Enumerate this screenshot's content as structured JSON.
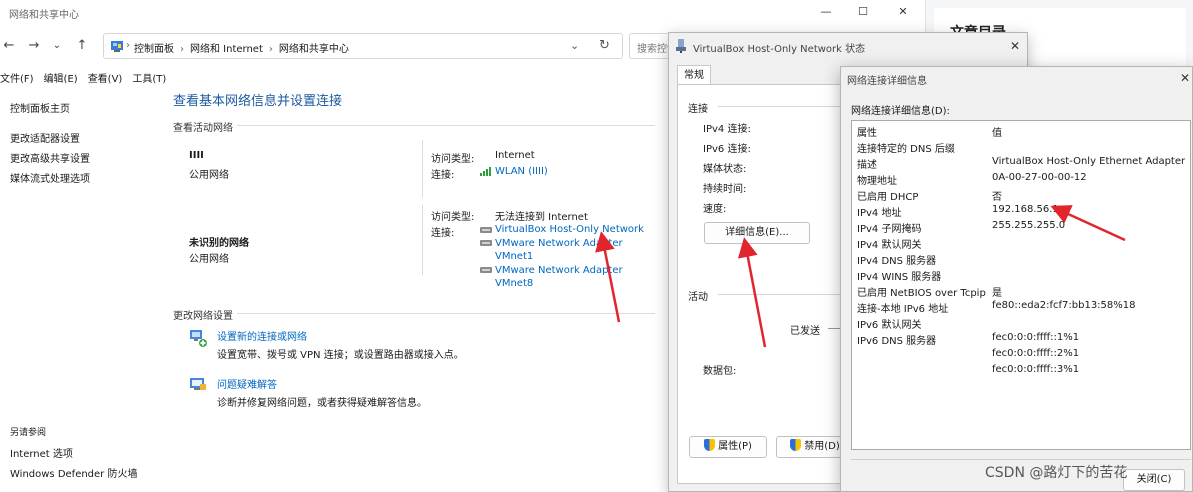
{
  "control_panel": {
    "window_title": "网络和共享中心",
    "window_controls": [
      "—",
      "☐",
      "✕"
    ],
    "nav": {
      "back": "←",
      "forward": "→",
      "recent": "⌄",
      "up": "↑"
    },
    "breadcrumbs": [
      "控制面板",
      "网络和 Internet",
      "网络和共享中心"
    ],
    "breadcrumb_sep": "›",
    "address_dropdown": "⌄",
    "refresh": "↻",
    "search_placeholder": "搜索控制",
    "menu": [
      "文件(F)",
      "编辑(E)",
      "查看(V)",
      "工具(T)"
    ],
    "left_nav": {
      "items": [
        "控制面板主页",
        "更改适配器设置",
        "更改高级共享设置",
        "媒体流式处理选项"
      ],
      "see_also_title": "另请参阅",
      "see_also": [
        "Internet 选项",
        "Windows Defender 防火墙"
      ]
    },
    "main_title": "查看基本网络信息并设置连接",
    "active_networks_title": "查看活动网络",
    "networks": [
      {
        "name": "IIII",
        "category": "公用网络",
        "access_label": "访问类型:",
        "access_value": "Internet",
        "conn_label": "连接:",
        "connections": [
          "WLAN (IIII)"
        ]
      },
      {
        "name": "未识别的网络",
        "category": "公用网络",
        "access_label": "访问类型:",
        "access_value": "无法连接到 Internet",
        "conn_label": "连接:",
        "connections": [
          "VirtualBox Host-Only Network",
          "VMware Network Adapter VMnet1",
          "VMware Network Adapter VMnet8"
        ]
      }
    ],
    "change_settings_title": "更改网络设置",
    "tasks": [
      {
        "title": "设置新的连接或网络",
        "desc": "设置宽带、拨号或 VPN 连接；或设置路由器或接入点。"
      },
      {
        "title": "问题疑难解答",
        "desc": "诊断并修复网络问题，或者获得疑难解答信息。"
      }
    ]
  },
  "csdn": {
    "toc_title": "文章目录",
    "watermark": "CSDN @路灯下的苦花"
  },
  "status_dialog": {
    "title": "VirtualBox Host-Only Network 状态",
    "close": "✕",
    "tab": "常规",
    "connection_group": "连接",
    "fields": [
      "IPv4 连接:",
      "IPv6 连接:",
      "媒体状态:",
      "持续时间:",
      "速度:"
    ],
    "details_button": "详细信息(E)...",
    "activity_group": "活动",
    "sent_label": "已发送",
    "packets_label": "数据包:",
    "properties_button": "属性(P)",
    "disable_button": "禁用(D)"
  },
  "details_dialog": {
    "title": "网络连接详细信息",
    "close": "✕",
    "caption": "网络连接详细信息(D):",
    "header": {
      "property": "属性",
      "value": "值"
    },
    "rows": [
      {
        "property": "连接特定的 DNS 后缀",
        "value": ""
      },
      {
        "property": "描述",
        "value": "VirtualBox Host-Only Ethernet Adapter"
      },
      {
        "property": "物理地址",
        "value": "0A-00-27-00-00-12"
      },
      {
        "property": "已启用 DHCP",
        "value": "否"
      },
      {
        "property": "IPv4 地址",
        "value": "192.168.56.1"
      },
      {
        "property": "IPv4 子网掩码",
        "value": "255.255.255.0"
      },
      {
        "property": "IPv4 默认网关",
        "value": ""
      },
      {
        "property": "IPv4 DNS 服务器",
        "value": ""
      },
      {
        "property": "IPv4 WINS 服务器",
        "value": ""
      },
      {
        "property": "已启用 NetBIOS over Tcpip",
        "value": "是"
      },
      {
        "property": "连接-本地 IPv6 地址",
        "value": "fe80::eda2:fcf7:bb13:58%18"
      },
      {
        "property": "IPv6 默认网关",
        "value": ""
      },
      {
        "property": "IPv6 DNS 服务器",
        "value": "fec0:0:0:ffff::1%1"
      },
      {
        "property": "",
        "value": "fec0:0:0:ffff::2%1"
      },
      {
        "property": "",
        "value": "fec0:0:0:ffff::3%1"
      }
    ],
    "close_button": "关闭(C)"
  },
  "colors": {
    "link": "#0067c0",
    "title_blue": "#1e5aa0",
    "annotation_red": "#e0262c"
  }
}
